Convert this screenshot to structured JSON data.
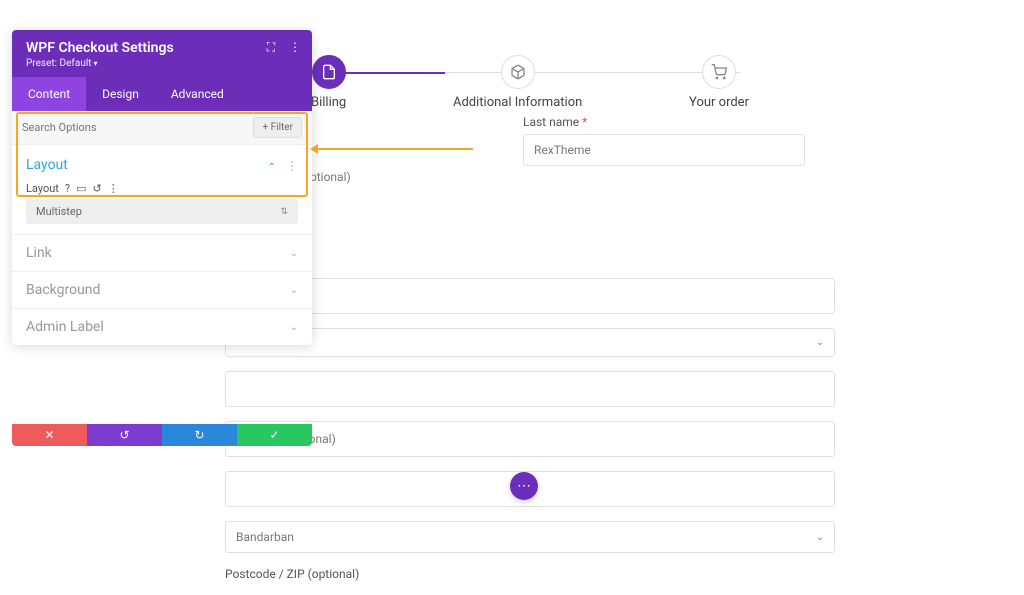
{
  "panel": {
    "title": "WPF Checkout Settings",
    "preset_label": "Preset: Default",
    "tabs": {
      "content": "Content",
      "design": "Design",
      "advanced": "Advanced"
    },
    "search_placeholder": "Search Options",
    "filter_label": "+ Filter",
    "sections": {
      "layout": {
        "title": "Layout",
        "field_label": "Layout",
        "value": "Multistep"
      },
      "link": {
        "title": "Link"
      },
      "background": {
        "title": "Background"
      },
      "admin_label": {
        "title": "Admin Label"
      }
    }
  },
  "steps": {
    "billing": "Billing",
    "additional": "Additional Information",
    "order": "Your order"
  },
  "form": {
    "last_name_label": "Last name",
    "last_name_value": "RexTheme",
    "company_hint": "ptional)",
    "address_hint": "unit, etc. (optional)",
    "district_value": "Bandarban",
    "postcode_label": "Postcode / ZIP (optional)"
  }
}
